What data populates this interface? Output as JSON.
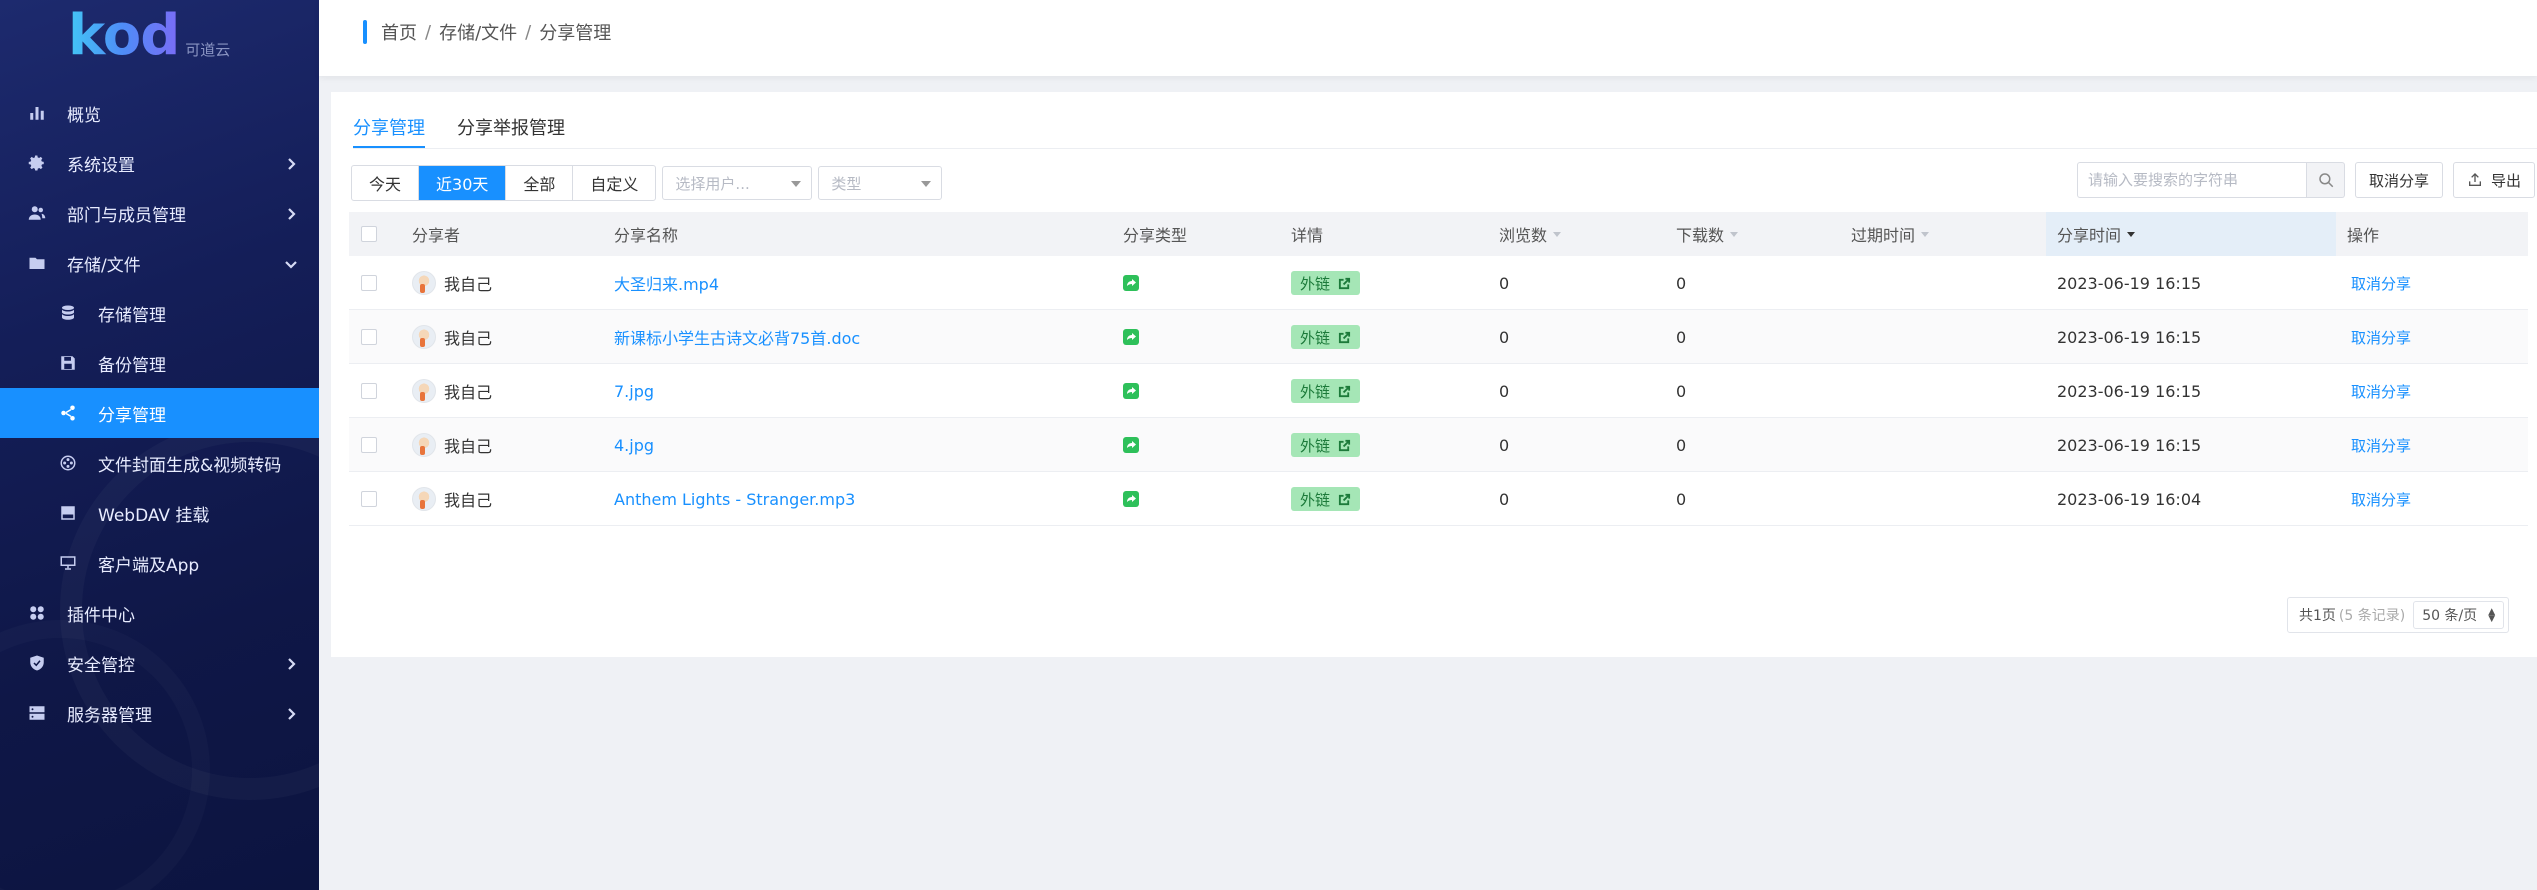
{
  "logo": {
    "text": "kod",
    "sub": "可道云"
  },
  "sidebar": {
    "items": [
      {
        "key": "overview",
        "label": "概览",
        "icon": "chart-bar-icon",
        "sub": false,
        "active": false,
        "arrow": ""
      },
      {
        "key": "system-settings",
        "label": "系统设置",
        "icon": "gear-icon",
        "sub": false,
        "active": false,
        "arrow": "right"
      },
      {
        "key": "dept-members",
        "label": "部门与成员管理",
        "icon": "users-icon",
        "sub": false,
        "active": false,
        "arrow": "right"
      },
      {
        "key": "storage-files",
        "label": "存储/文件",
        "icon": "folder-icon",
        "sub": false,
        "active": false,
        "arrow": "down"
      },
      {
        "key": "storage-manage",
        "label": "存储管理",
        "icon": "database-icon",
        "sub": true,
        "active": false,
        "arrow": ""
      },
      {
        "key": "backup-manage",
        "label": "备份管理",
        "icon": "save-icon",
        "sub": true,
        "active": false,
        "arrow": ""
      },
      {
        "key": "share-manage",
        "label": "分享管理",
        "icon": "share-icon",
        "sub": true,
        "active": true,
        "arrow": ""
      },
      {
        "key": "cover-transcode",
        "label": "文件封面生成&视频转码",
        "icon": "film-reel-icon",
        "sub": true,
        "active": false,
        "arrow": ""
      },
      {
        "key": "webdav",
        "label": "WebDAV 挂载",
        "icon": "drive-icon",
        "sub": true,
        "active": false,
        "arrow": ""
      },
      {
        "key": "client-app",
        "label": "客户端及App",
        "icon": "monitor-icon",
        "sub": true,
        "active": false,
        "arrow": ""
      },
      {
        "key": "plugins",
        "label": "插件中心",
        "icon": "grid-icon",
        "sub": false,
        "active": false,
        "arrow": ""
      },
      {
        "key": "security",
        "label": "安全管控",
        "icon": "shield-icon",
        "sub": false,
        "active": false,
        "arrow": "right"
      },
      {
        "key": "server",
        "label": "服务器管理",
        "icon": "server-icon",
        "sub": false,
        "active": false,
        "arrow": "right"
      }
    ]
  },
  "breadcrumb": {
    "home": "首页",
    "sep1": "/",
    "section": "存储/文件",
    "sep2": "/",
    "current": "分享管理"
  },
  "tabs": [
    {
      "label": "分享管理",
      "active": true
    },
    {
      "label": "分享举报管理",
      "active": false
    }
  ],
  "filters": {
    "ranges": [
      {
        "label": "今天",
        "active": false
      },
      {
        "label": "近30天",
        "active": true
      },
      {
        "label": "全部",
        "active": false
      },
      {
        "label": "自定义",
        "active": false
      }
    ],
    "user_placeholder": "选择用户...",
    "type_placeholder": "类型"
  },
  "toolbar": {
    "search_placeholder": "请输入要搜索的字符串",
    "cancel_share_label": "取消分享",
    "export_label": "导出"
  },
  "table": {
    "headers": {
      "sharer": "分享者",
      "name": "分享名称",
      "type": "分享类型",
      "detail": "详情",
      "views": "浏览数",
      "downloads": "下载数",
      "expire": "过期时间",
      "share_time": "分享时间",
      "action": "操作"
    },
    "rows": [
      {
        "sharer": "我自己",
        "name": "大圣归来.mp4",
        "detail": "外链",
        "views": "0",
        "downloads": "0",
        "expire": "",
        "time": "2023-06-19 16:15",
        "action": "取消分享"
      },
      {
        "sharer": "我自己",
        "name": "新课标小学生古诗文必背75首.doc",
        "detail": "外链",
        "views": "0",
        "downloads": "0",
        "expire": "",
        "time": "2023-06-19 16:15",
        "action": "取消分享"
      },
      {
        "sharer": "我自己",
        "name": "7.jpg",
        "detail": "外链",
        "views": "0",
        "downloads": "0",
        "expire": "",
        "time": "2023-06-19 16:15",
        "action": "取消分享"
      },
      {
        "sharer": "我自己",
        "name": "4.jpg",
        "detail": "外链",
        "views": "0",
        "downloads": "0",
        "expire": "",
        "time": "2023-06-19 16:15",
        "action": "取消分享"
      },
      {
        "sharer": "我自己",
        "name": "Anthem Lights - Stranger.mp3",
        "detail": "外链",
        "views": "0",
        "downloads": "0",
        "expire": "",
        "time": "2023-06-19 16:04",
        "action": "取消分享"
      }
    ]
  },
  "pagination": {
    "pages": "共1页",
    "records": "(5 条记录)",
    "page_size": "50 条/页"
  },
  "colors": {
    "accent": "#1890ff",
    "sidebar_bg": "#141e58",
    "badge_bg": "#a5e6b6",
    "share_type": "#2ec05a"
  }
}
